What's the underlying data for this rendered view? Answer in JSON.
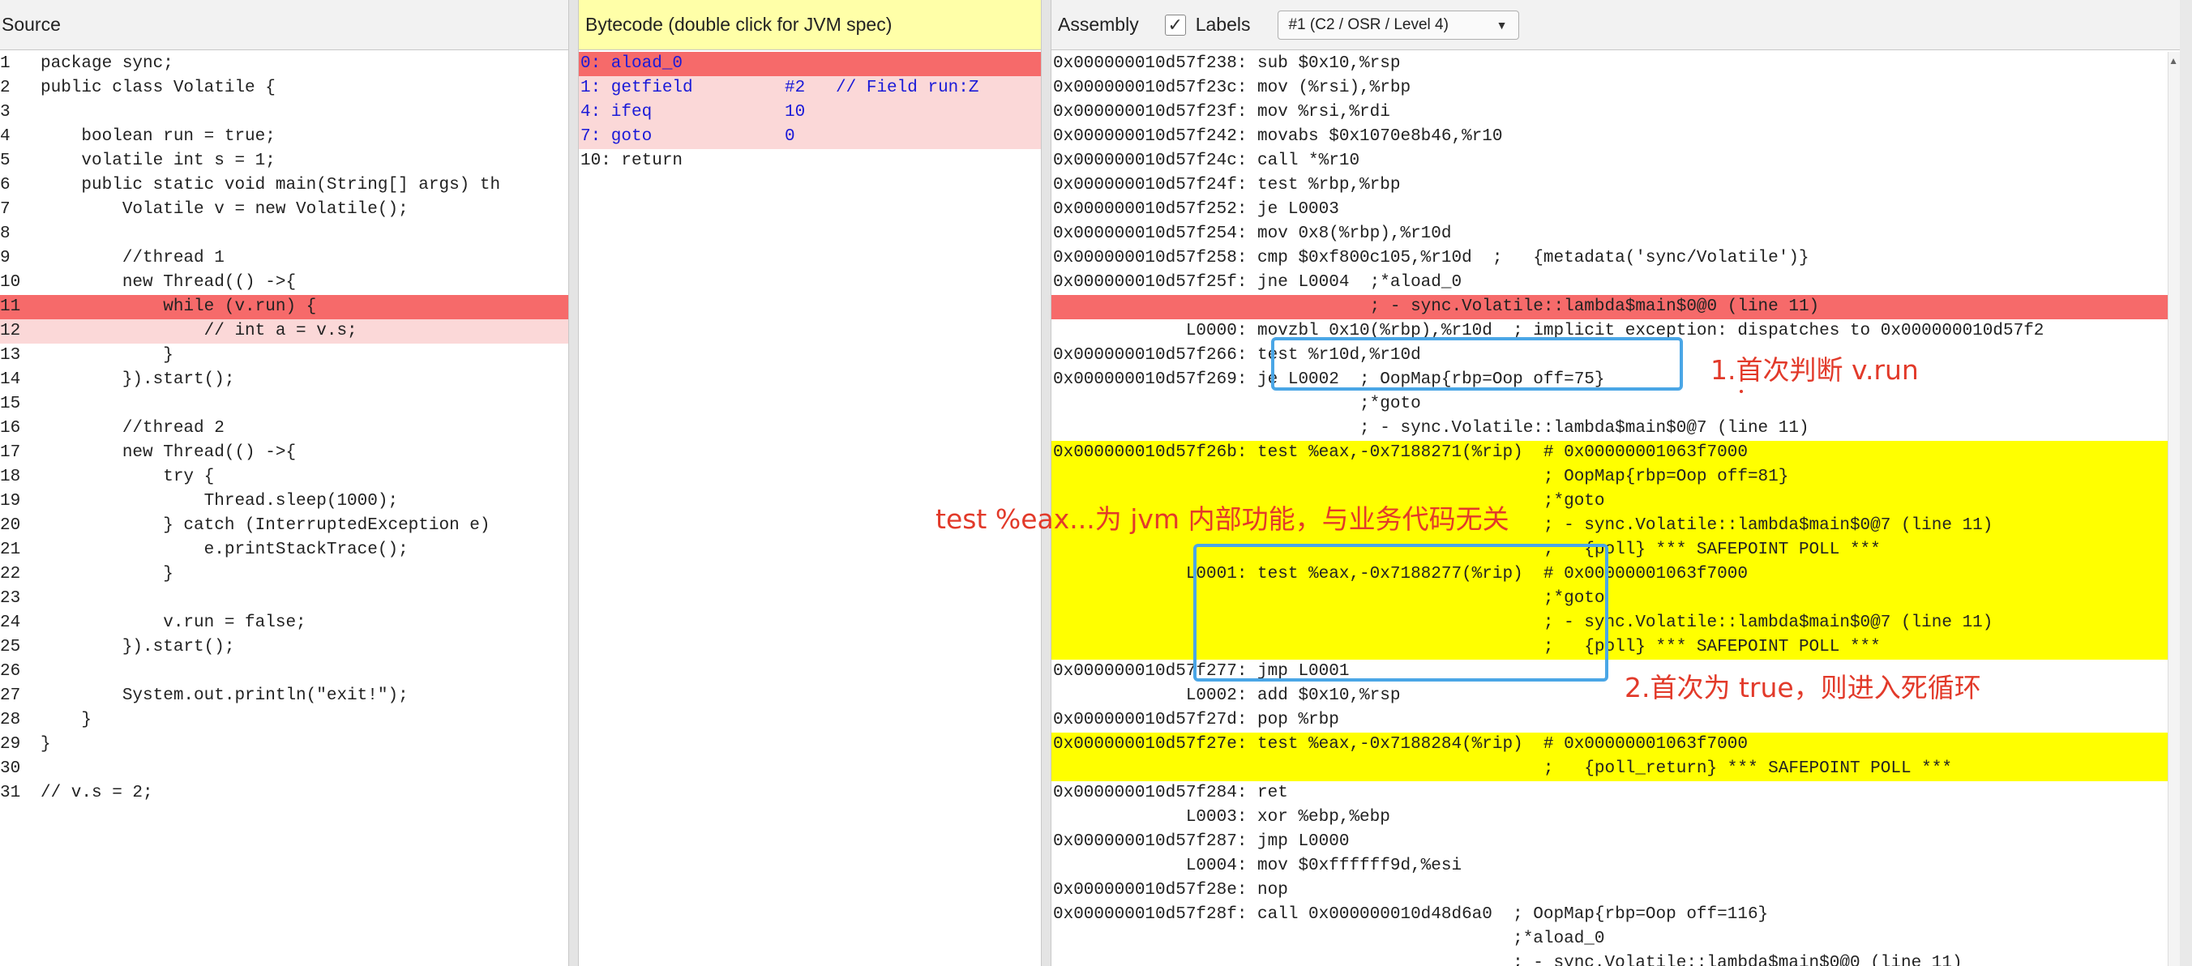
{
  "source": {
    "title": "Source",
    "lines": [
      {
        "n": "1",
        "t": "package sync;",
        "hl": ""
      },
      {
        "n": "2",
        "t": "public class Volatile {",
        "hl": ""
      },
      {
        "n": "3",
        "t": "",
        "hl": ""
      },
      {
        "n": "4",
        "t": "    boolean run = true;",
        "hl": ""
      },
      {
        "n": "5",
        "t": "    volatile int s = 1;",
        "hl": ""
      },
      {
        "n": "6",
        "t": "    public static void main(String[] args) th",
        "hl": ""
      },
      {
        "n": "7",
        "t": "        Volatile v = new Volatile();",
        "hl": ""
      },
      {
        "n": "8",
        "t": "",
        "hl": ""
      },
      {
        "n": "9",
        "t": "        //thread 1",
        "hl": ""
      },
      {
        "n": "10",
        "t": "        new Thread(() ->{",
        "hl": ""
      },
      {
        "n": "11",
        "t": "            while (v.run) {",
        "hl": "strong"
      },
      {
        "n": "12",
        "t": "                // int a = v.s;",
        "hl": "light"
      },
      {
        "n": "13",
        "t": "            }",
        "hl": ""
      },
      {
        "n": "14",
        "t": "        }).start();",
        "hl": ""
      },
      {
        "n": "15",
        "t": "",
        "hl": ""
      },
      {
        "n": "16",
        "t": "        //thread 2",
        "hl": ""
      },
      {
        "n": "17",
        "t": "        new Thread(() ->{",
        "hl": ""
      },
      {
        "n": "18",
        "t": "            try {",
        "hl": ""
      },
      {
        "n": "19",
        "t": "                Thread.sleep(1000);",
        "hl": ""
      },
      {
        "n": "20",
        "t": "            } catch (InterruptedException e)",
        "hl": ""
      },
      {
        "n": "21",
        "t": "                e.printStackTrace();",
        "hl": ""
      },
      {
        "n": "22",
        "t": "            }",
        "hl": ""
      },
      {
        "n": "23",
        "t": "",
        "hl": ""
      },
      {
        "n": "24",
        "t": "            v.run = false;",
        "hl": ""
      },
      {
        "n": "25",
        "t": "        }).start();",
        "hl": ""
      },
      {
        "n": "26",
        "t": "",
        "hl": ""
      },
      {
        "n": "27",
        "t": "        System.out.println(\"exit!\");",
        "hl": ""
      },
      {
        "n": "28",
        "t": "    }",
        "hl": ""
      },
      {
        "n": "29",
        "t": "}",
        "hl": ""
      },
      {
        "n": "30",
        "t": "",
        "hl": ""
      },
      {
        "n": "31",
        "t": "// v.s = 2;",
        "hl": ""
      }
    ]
  },
  "bytecode": {
    "title": "Bytecode (double click for JVM spec)",
    "lines": [
      {
        "t": "0: aload_0",
        "hl": "strong",
        "blue": true
      },
      {
        "t": "1: getfield         #2   // Field run:Z",
        "hl": "light",
        "blue": true
      },
      {
        "t": "4: ifeq             10",
        "hl": "light",
        "blue": true
      },
      {
        "t": "7: goto             0",
        "hl": "light",
        "blue": true
      },
      {
        "t": "10: return",
        "hl": "",
        "blue": false
      }
    ]
  },
  "assembly": {
    "title": "Assembly",
    "labels_checkbox": "✓",
    "labels_label": "Labels",
    "compilation_select": "#1  (C2 / OSR / Level 4)",
    "lines": [
      {
        "t": "0x000000010d57f238: sub $0x10,%rsp",
        "hl": ""
      },
      {
        "t": "0x000000010d57f23c: mov (%rsi),%rbp",
        "hl": ""
      },
      {
        "t": "0x000000010d57f23f: mov %rsi,%rdi",
        "hl": ""
      },
      {
        "t": "0x000000010d57f242: movabs $0x1070e8b46,%r10",
        "hl": ""
      },
      {
        "t": "0x000000010d57f24c: call *%r10",
        "hl": ""
      },
      {
        "t": "0x000000010d57f24f: test %rbp,%rbp",
        "hl": ""
      },
      {
        "t": "0x000000010d57f252: je L0003",
        "hl": ""
      },
      {
        "t": "0x000000010d57f254: mov 0x8(%rbp),%r10d",
        "hl": ""
      },
      {
        "t": "0x000000010d57f258: cmp $0xf800c105,%r10d  ;   {metadata('sync/Volatile')}",
        "hl": ""
      },
      {
        "t": "0x000000010d57f25f: jne L0004  ;*aload_0",
        "hl": ""
      },
      {
        "t": "                               ; - sync.Volatile::lambda$main$0@0 (line 11)",
        "hl": "strong"
      },
      {
        "t": "             L0000: movzbl 0x10(%rbp),%r10d  ; implicit exception: dispatches to 0x000000010d57f2",
        "hl": ""
      },
      {
        "t": "0x000000010d57f266: test %r10d,%r10d",
        "hl": ""
      },
      {
        "t": "0x000000010d57f269: je L0002  ; OopMap{rbp=Oop off=75}",
        "hl": ""
      },
      {
        "t": "                              ;*goto",
        "hl": ""
      },
      {
        "t": "                              ; - sync.Volatile::lambda$main$0@7 (line 11)",
        "hl": ""
      },
      {
        "t": "0x000000010d57f26b: test %eax,-0x7188271(%rip)  # 0x00000001063f7000",
        "hl": "yellow"
      },
      {
        "t": "                                                ; OopMap{rbp=Oop off=81}",
        "hl": "yellow"
      },
      {
        "t": "                                                ;*goto",
        "hl": "yellow"
      },
      {
        "t": "                                                ; - sync.Volatile::lambda$main$0@7 (line 11)",
        "hl": "yellow"
      },
      {
        "t": "                                                ;   {poll} *** SAFEPOINT POLL ***",
        "hl": "yellow"
      },
      {
        "t": "             L0001: test %eax,-0x7188277(%rip)  # 0x00000001063f7000",
        "hl": "yellow"
      },
      {
        "t": "                                                ;*goto",
        "hl": "yellow"
      },
      {
        "t": "                                                ; - sync.Volatile::lambda$main$0@7 (line 11)",
        "hl": "yellow"
      },
      {
        "t": "                                                ;   {poll} *** SAFEPOINT POLL ***",
        "hl": "yellow"
      },
      {
        "t": "0x000000010d57f277: jmp L0001",
        "hl": ""
      },
      {
        "t": "             L0002: add $0x10,%rsp",
        "hl": ""
      },
      {
        "t": "0x000000010d57f27d: pop %rbp",
        "hl": ""
      },
      {
        "t": "0x000000010d57f27e: test %eax,-0x7188284(%rip)  # 0x00000001063f7000",
        "hl": "yellow"
      },
      {
        "t": "                                                ;   {poll_return} *** SAFEPOINT POLL ***",
        "hl": "yellow"
      },
      {
        "t": "0x000000010d57f284: ret",
        "hl": ""
      },
      {
        "t": "             L0003: xor %ebp,%ebp",
        "hl": ""
      },
      {
        "t": "0x000000010d57f287: jmp L0000",
        "hl": ""
      },
      {
        "t": "             L0004: mov $0xffffff9d,%esi",
        "hl": ""
      },
      {
        "t": "0x000000010d57f28e: nop",
        "hl": ""
      },
      {
        "t": "0x000000010d57f28f: call 0x000000010d48d6a0  ; OopMap{rbp=Oop off=116}",
        "hl": ""
      },
      {
        "t": "                                             ;*aload_0",
        "hl": ""
      },
      {
        "t": "                                             ; - sync.Volatile::lambda$main$0@0 (line 11)",
        "hl": ""
      }
    ]
  },
  "annotations": {
    "note1": "1.首次判断 v.run",
    "note2": "test %eax...为 jvm 内部功能，与业务代码无关",
    "note3": "2.首次为 true，则进入死循环",
    "color": "#e23a2a",
    "box_color": "#4aa6e6"
  },
  "icons": {
    "dropdown": "chevron-down-icon",
    "scroll": "scroll-up-arrow-icon"
  }
}
